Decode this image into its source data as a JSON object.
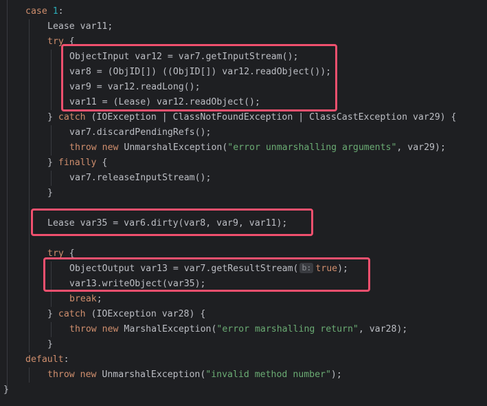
{
  "code": {
    "case1_kw": "case",
    "case1_num": "1",
    "case1_colon": ":",
    "lease_decl": "Lease var11;",
    "try1_kw": "try",
    "try1_brace": " {",
    "l_objinput": "ObjectInput var12 = var7.getInputStream();",
    "l_var8": "var8 = (ObjID[]) ((ObjID[]) var12.readObject());",
    "l_var9": "var9 = var12.readLong();",
    "l_var11": "var11 = (Lease) var12.readObject();",
    "catch1_pre": "} ",
    "catch1_kw": "catch",
    "catch1_rest": " (IOException | ClassNotFoundException | ClassCastException var29) {",
    "l_discard": "var7.discardPendingRefs();",
    "throw1_kw": "throw",
    "throw1_new": "new",
    "throw1_cls": " UnmarshalException(",
    "throw1_str": "\"error unmarshalling arguments\"",
    "throw1_end": ", var29);",
    "finally_pre": "} ",
    "finally_kw": "finally",
    "finally_brace": " {",
    "l_release": "var7.releaseInputStream();",
    "close1": "}",
    "l_lease35": "Lease var35 = var6.dirty(var8, var9, var11);",
    "try2_kw": "try",
    "try2_brace": " {",
    "l_objout": "ObjectOutput var13 = var7.getResultStream(",
    "hint_label": "b:",
    "true_kw": "true",
    "l_objout_end": ");",
    "l_write": "var13.writeObject(var35);",
    "break_kw": "break",
    "break_semi": ";",
    "catch2_pre": "} ",
    "catch2_kw": "catch",
    "catch2_rest": " (IOException var28) {",
    "throw2_kw": "throw",
    "throw2_new": "new",
    "throw2_cls": " MarshalException(",
    "throw2_str": "\"error marshalling return\"",
    "throw2_end": ", var28);",
    "close2": "}",
    "default_kw": "default",
    "default_colon": ":",
    "throw3_kw": "throw",
    "throw3_new": "new",
    "throw3_cls": " UnmarshalException(",
    "throw3_str": "\"invalid method number\"",
    "throw3_end": ");",
    "close3": "}"
  },
  "colors": {
    "background": "#1e1f22",
    "keyword": "#cf8e6d",
    "number": "#2aacb8",
    "string": "#6aab73",
    "text": "#bcbec4",
    "highlight_box": "#f0506e"
  }
}
